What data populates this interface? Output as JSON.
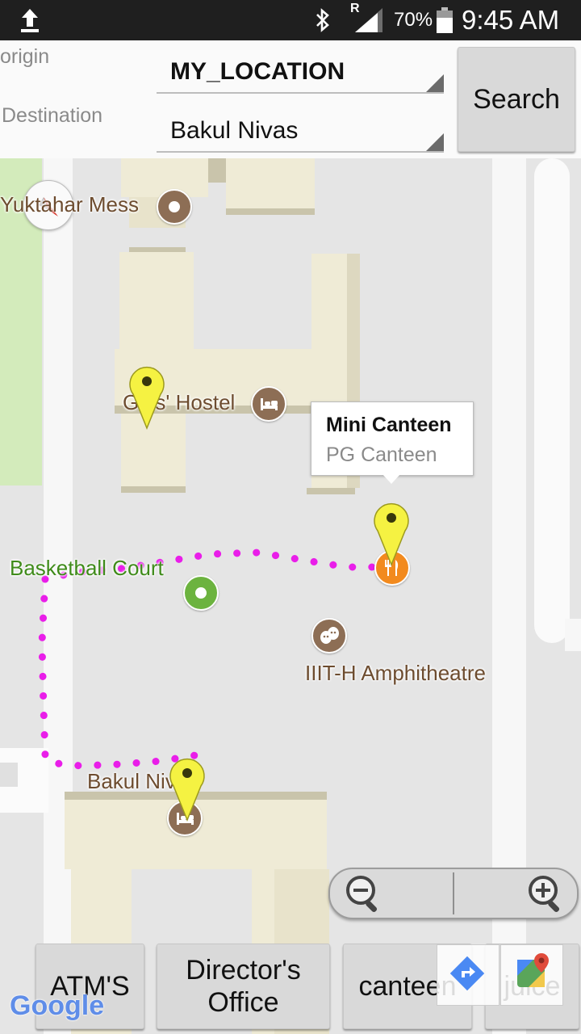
{
  "status": {
    "battery": "70%",
    "time": "9:45 AM",
    "signal_badge": "R"
  },
  "form": {
    "origin_label": "origin",
    "destination_label": "Destination",
    "origin_value": "MY_LOCATION",
    "destination_value": "Bakul Nivas",
    "search_label": "Search"
  },
  "map": {
    "labels": {
      "yuktahar": "Yuktahar Mess",
      "girls_hostel": "Girls' Hostel",
      "basketball": "Basketball Court",
      "amphitheatre": "IIIT-H Amphitheatre",
      "bakul": "Bakul Nivas"
    },
    "info_window": {
      "title": "Mini Canteen",
      "subtitle": "PG Canteen"
    },
    "attribution": "Google",
    "route_color": "#e91ee9",
    "marker_color": "#f5f242"
  },
  "quick_buttons": {
    "atms": "ATM'S",
    "directors_line1": "Director's",
    "directors_line2": "Office",
    "canteen": "canteen",
    "juice": "juice"
  }
}
